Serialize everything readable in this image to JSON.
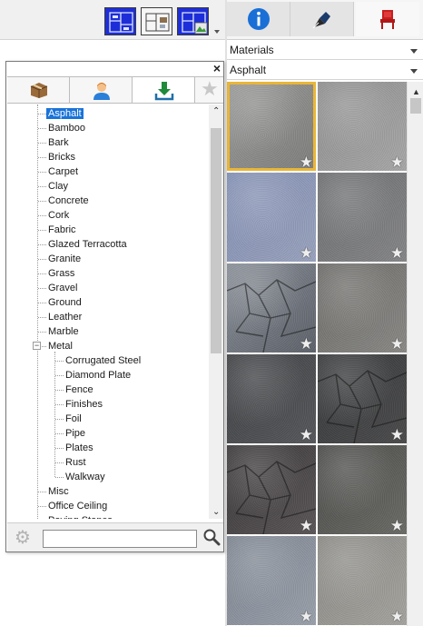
{
  "toolbar": {
    "view_buttons": [
      "floor-plan-view-icon",
      "split-view-icon",
      "3d-view-icon"
    ],
    "dropdown_icon": "chevron-down-icon"
  },
  "library_tabs": {
    "items": [
      "info-icon",
      "pen-nib-icon",
      "chair-icon"
    ],
    "active": "chair-icon"
  },
  "selectors": {
    "category": "Materials",
    "subcategory": "Asphalt"
  },
  "dialog": {
    "close_label": "×",
    "tabs": [
      "box-icon",
      "user-icon",
      "download-icon",
      "star-icon"
    ],
    "active_tab": "download-icon"
  },
  "tree": {
    "items": [
      {
        "label": "Asphalt",
        "level": 1,
        "selected": true
      },
      {
        "label": "Bamboo",
        "level": 1
      },
      {
        "label": "Bark",
        "level": 1
      },
      {
        "label": "Bricks",
        "level": 1
      },
      {
        "label": "Carpet",
        "level": 1
      },
      {
        "label": "Clay",
        "level": 1
      },
      {
        "label": "Concrete",
        "level": 1
      },
      {
        "label": "Cork",
        "level": 1
      },
      {
        "label": "Fabric",
        "level": 1
      },
      {
        "label": "Glazed Terracotta",
        "level": 1
      },
      {
        "label": "Granite",
        "level": 1
      },
      {
        "label": "Grass",
        "level": 1
      },
      {
        "label": "Gravel",
        "level": 1
      },
      {
        "label": "Ground",
        "level": 1
      },
      {
        "label": "Leather",
        "level": 1
      },
      {
        "label": "Marble",
        "level": 1
      },
      {
        "label": "Metal",
        "level": 1,
        "expanded": true
      },
      {
        "label": "Corrugated Steel",
        "level": 2
      },
      {
        "label": "Diamond Plate",
        "level": 2
      },
      {
        "label": "Fence",
        "level": 2
      },
      {
        "label": "Finishes",
        "level": 2
      },
      {
        "label": "Foil",
        "level": 2
      },
      {
        "label": "Pipe",
        "level": 2
      },
      {
        "label": "Plates",
        "level": 2
      },
      {
        "label": "Rust",
        "level": 2
      },
      {
        "label": "Walkway",
        "level": 2
      },
      {
        "label": "Misc",
        "level": 1
      },
      {
        "label": "Office Ceiling",
        "level": 1
      },
      {
        "label": "Paving Stones",
        "level": 1
      }
    ]
  },
  "search": {
    "value": "",
    "placeholder": ""
  },
  "materials": {
    "tiles": [
      {
        "tone": "#9a9a99",
        "shade": "#7f7f7e",
        "selected": true
      },
      {
        "tone": "#8f8f8f",
        "shade": "#a8a8a8"
      },
      {
        "tone": "#8290b5",
        "shade": "#9aa3be"
      },
      {
        "tone": "#6d6e70",
        "shade": "#858688"
      },
      {
        "tone": "#8a9099",
        "shade": "#5d626a",
        "cracked": true
      },
      {
        "tone": "#6c6b68",
        "shade": "#8a8986"
      },
      {
        "tone": "#3f4144",
        "shade": "#55575a"
      },
      {
        "tone": "#37393b",
        "shade": "#4a4a4b",
        "cracked": true
      },
      {
        "tone": "#3a3839",
        "shade": "#5a5557",
        "cracked": true
      },
      {
        "tone": "#4a4b48",
        "shade": "#6a6a66"
      },
      {
        "tone": "#7e8591",
        "shade": "#9aa1ab"
      },
      {
        "tone": "#8b8a85",
        "shade": "#a5a49f"
      }
    ],
    "favorite_icon": "star-icon",
    "star_glyph": "★"
  },
  "colors": {
    "selection_blue": "#1a73d9",
    "tile_highlight": "#e9b636",
    "info_blue": "#1a6fd6",
    "chair_red": "#c81e1e",
    "download_green": "#1f8a3a"
  }
}
